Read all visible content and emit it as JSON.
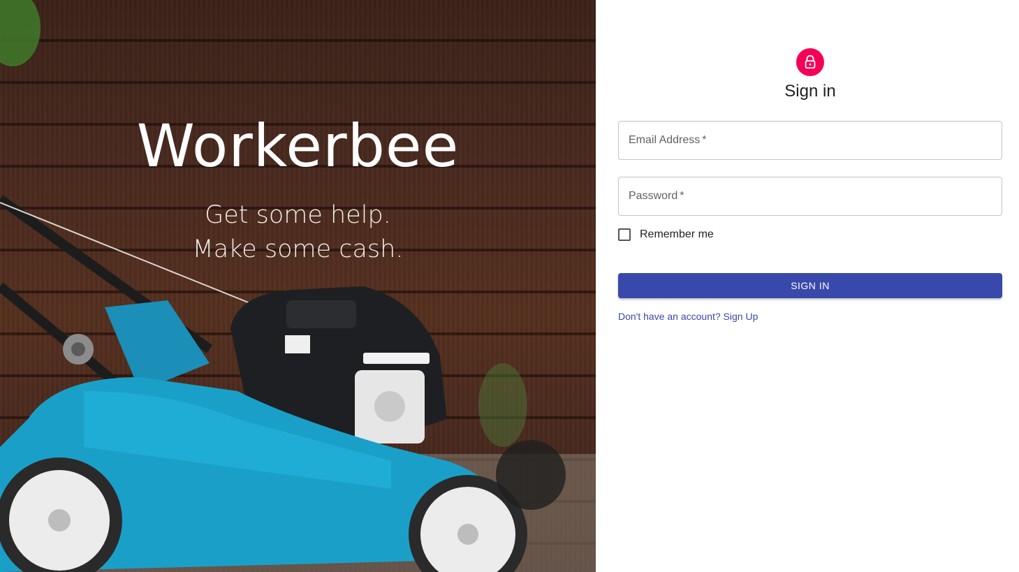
{
  "hero": {
    "title": "Workerbee",
    "tagline_line1": "Get some help.",
    "tagline_line2": "Make some cash.",
    "image_subject": "lawn-mower-photo"
  },
  "signin": {
    "icon": "lock-icon",
    "title": "Sign in",
    "email": {
      "label": "Email Address",
      "required_mark": "*",
      "value": ""
    },
    "password": {
      "label": "Password",
      "required_mark": "*",
      "value": ""
    },
    "remember_me": {
      "label": "Remember me",
      "checked": false
    },
    "submit_label": "SIGN IN",
    "signup_link": "Don't have an account? Sign Up"
  },
  "colors": {
    "accent_pink": "#f50057",
    "primary_indigo": "#3949ab",
    "mower_blue": "#1aa0c8"
  }
}
